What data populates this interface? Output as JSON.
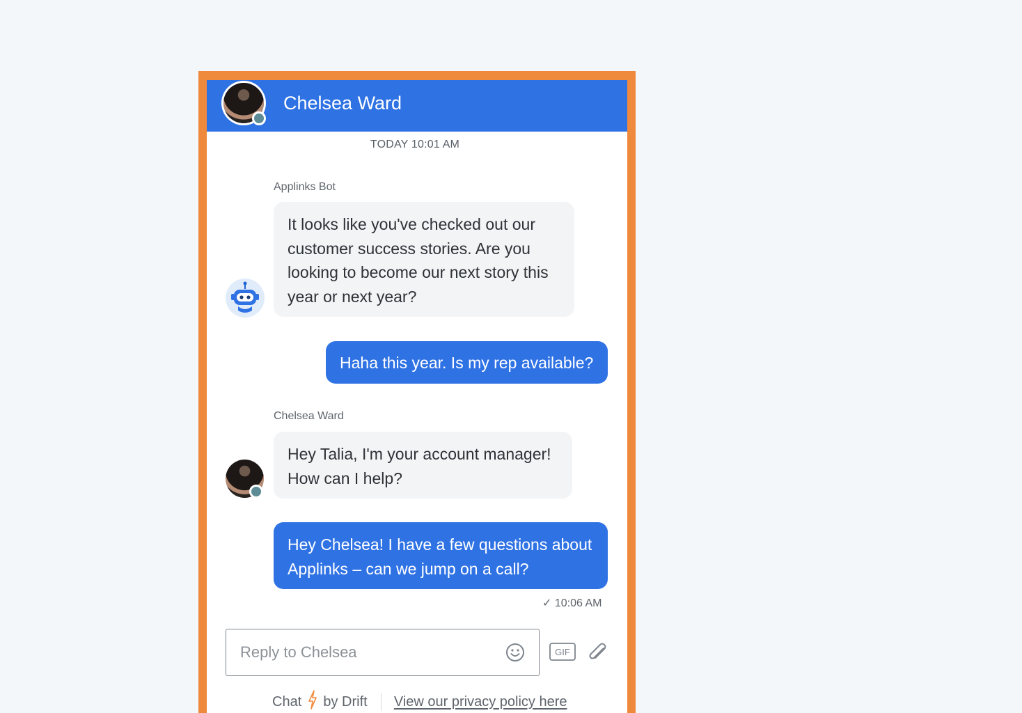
{
  "header": {
    "agent_name": "Chelsea Ward"
  },
  "conversation": {
    "date_stamp": "TODAY 10:01 AM",
    "messages": [
      {
        "sender": "Applinks Bot",
        "direction": "incoming",
        "text": "It looks like you've checked out our customer success stories. Are you looking to become our next story this year or next year?"
      },
      {
        "direction": "outgoing",
        "text": "Haha this year. Is my rep available?"
      },
      {
        "sender": "Chelsea Ward",
        "direction": "incoming",
        "text": "Hey Talia, I'm your account manager! How can I help?"
      },
      {
        "direction": "outgoing",
        "text": "Hey Chelsea! I have a few questions about Applinks – can we jump on a call?"
      }
    ],
    "last_sent_time": "✓ 10:06 AM"
  },
  "composer": {
    "placeholder": "Reply to Chelsea",
    "gif_label": "GIF"
  },
  "footer": {
    "chat_label": "Chat",
    "by_label": "by Drift",
    "privacy_link": "View our privacy policy here"
  },
  "icons": {
    "bot": "robot-icon",
    "emoji": "smiley-icon",
    "gif": "gif-icon",
    "attach": "paperclip-icon",
    "bolt": "lightning-bolt-icon"
  },
  "colors": {
    "frame": "#ef8a3c",
    "header": "#2f72e4",
    "outgoing_bubble": "#2f72e4",
    "incoming_bubble": "#f3f4f6",
    "background": "#f4f7fa",
    "status": "#5e8c96",
    "bolt": "#f08a3c"
  }
}
